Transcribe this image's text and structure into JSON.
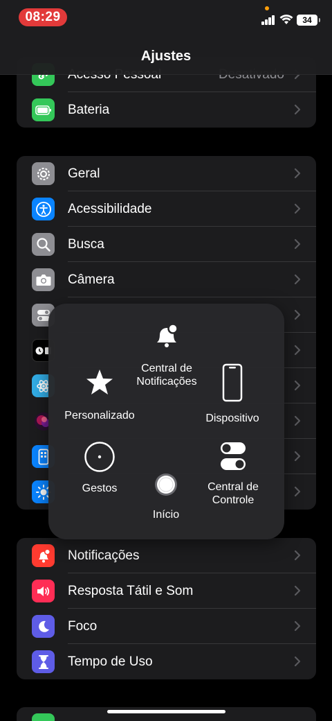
{
  "status_bar": {
    "time": "08:29",
    "battery": "34",
    "colors": {
      "time_pill": "#e23a3a",
      "mic_dot": "#ff9f0a"
    }
  },
  "header": {
    "title": "Ajustes"
  },
  "group_top": {
    "items": [
      {
        "label": "Acesso Pessoal",
        "value": "Desativado",
        "icon": "link-icon",
        "color": "#34c759"
      },
      {
        "label": "Bateria",
        "icon": "battery-icon",
        "color": "#34c759"
      }
    ]
  },
  "group_general": {
    "items": [
      {
        "label": "Geral",
        "icon": "gear-icon",
        "color": "#8e8e93"
      },
      {
        "label": "Acessibilidade",
        "icon": "accessibility-icon",
        "color": "#0a84ff"
      },
      {
        "label": "Busca",
        "icon": "search-icon",
        "color": "#8e8e93"
      },
      {
        "label": "Câmera",
        "icon": "camera-icon",
        "color": "#8e8e93"
      },
      {
        "label": "",
        "icon": "control-center-icon",
        "color": "#8e8e93"
      },
      {
        "label": "",
        "icon": "standby-icon",
        "color": "#000000"
      },
      {
        "label": "",
        "icon": "wallpaper-icon",
        "color": "#32ade6"
      },
      {
        "label": "",
        "icon": "siri-icon",
        "color": "#1c1c1e"
      },
      {
        "label": "",
        "icon": "home-screen-icon",
        "color": "#0a84ff"
      },
      {
        "label": "",
        "icon": "display-brightness-icon",
        "color": "#0a84ff"
      }
    ]
  },
  "group_notifications": {
    "items": [
      {
        "label": "Notificações",
        "icon": "bell-badge-icon",
        "color": "#ff3b30"
      },
      {
        "label": "Resposta Tátil e Som",
        "icon": "speaker-icon",
        "color": "#ff2d55"
      },
      {
        "label": "Foco",
        "icon": "moon-icon",
        "color": "#5e5ce6"
      },
      {
        "label": "Tempo de Uso",
        "icon": "hourglass-icon",
        "color": "#5e5ce6"
      }
    ]
  },
  "assistive_touch": {
    "notification_center": "Central de Notificações",
    "custom": "Personalizado",
    "device": "Dispositivo",
    "gestures": "Gestos",
    "control_center": "Central de Controle",
    "home": "Início"
  }
}
